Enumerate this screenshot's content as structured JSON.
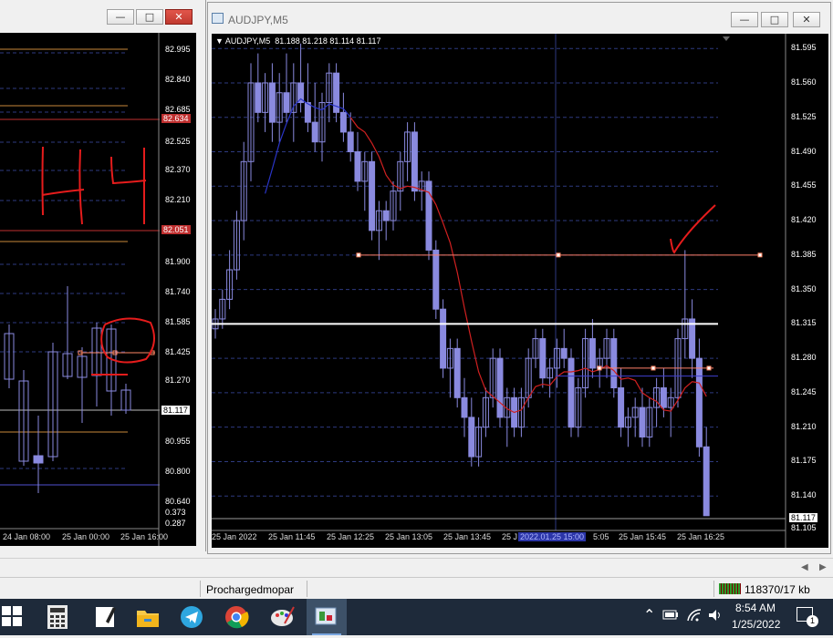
{
  "left_window": {
    "price_levels": [
      "82.995",
      "82.840",
      "82.685",
      "82.634",
      "82.525",
      "82.370",
      "82.210",
      "82.051",
      "81.900",
      "81.740",
      "81.585",
      "81.425",
      "81.270",
      "81.117",
      "80.955",
      "80.800",
      "80.640",
      "0.373",
      "0.287"
    ],
    "time_labels": [
      "24 Jan 08:00",
      "25 Jan 00:00",
      "25 Jan 16:00"
    ],
    "marker_red_1": "82.634",
    "marker_red_2": "82.051",
    "marker_current": "81.117",
    "annotation_text": "H4"
  },
  "right_window": {
    "title": "AUDJPY,M5",
    "chart_header": "AUDJPY,M5  81.188 81.218 81.114 81.117",
    "price_levels": [
      "81.595",
      "81.560",
      "81.525",
      "81.490",
      "81.455",
      "81.420",
      "81.385",
      "81.350",
      "81.315",
      "81.280",
      "81.245",
      "81.210",
      "81.175",
      "81.140",
      "81.117",
      "81.105"
    ],
    "current_price": "81.117",
    "time_labels": [
      "25 Jan 2022",
      "25 Jan 11:45",
      "25 Jan 12:25",
      "25 Jan 13:05",
      "25 Jan 13:45",
      "25 J",
      "2022.01.25 15:00",
      "5:05",
      "25 Jan 15:45",
      "25 Jan 16:25"
    ]
  },
  "window_buttons": {
    "minimize": "—",
    "maximize": "□",
    "close": "✕"
  },
  "statusbar": {
    "profile": "Prochargedmopar",
    "traffic": "118370/17 kb"
  },
  "taskbar": {
    "icons": [
      "windows-start",
      "calculator",
      "notepad",
      "file-explorer",
      "telegram",
      "chrome",
      "paint",
      "metatrader"
    ],
    "time": "8:54 AM",
    "date": "1/25/2022",
    "notif_count": "1"
  },
  "chart_data": {
    "type": "candlestick",
    "symbol": "AUDJPY",
    "timeframe": "M5",
    "ylim": [
      81.105,
      81.61
    ],
    "ohlc_header": {
      "open": 81.188,
      "high": 81.218,
      "low": 81.114,
      "close": 81.117
    },
    "candles": [
      [
        81.31,
        81.33,
        81.3,
        81.32
      ],
      [
        81.32,
        81.35,
        81.31,
        81.34
      ],
      [
        81.34,
        81.39,
        81.33,
        81.37
      ],
      [
        81.37,
        81.43,
        81.36,
        81.42
      ],
      [
        81.42,
        81.5,
        81.4,
        81.48
      ],
      [
        81.48,
        81.58,
        81.46,
        81.56
      ],
      [
        81.56,
        81.59,
        81.52,
        81.53
      ],
      [
        81.53,
        81.57,
        81.51,
        81.56
      ],
      [
        81.56,
        81.58,
        81.5,
        81.52
      ],
      [
        81.52,
        81.57,
        81.5,
        81.55
      ],
      [
        81.55,
        81.59,
        81.52,
        81.53
      ],
      [
        81.53,
        81.58,
        81.5,
        81.56
      ],
      [
        81.56,
        81.6,
        81.53,
        81.54
      ],
      [
        81.54,
        81.58,
        81.51,
        81.52
      ],
      [
        81.52,
        81.56,
        81.49,
        81.5
      ],
      [
        81.5,
        81.55,
        81.48,
        81.54
      ],
      [
        81.54,
        81.58,
        81.52,
        81.57
      ],
      [
        81.57,
        81.58,
        81.52,
        81.53
      ],
      [
        81.53,
        81.55,
        81.5,
        81.51
      ],
      [
        81.51,
        81.53,
        81.48,
        81.49
      ],
      [
        81.49,
        81.51,
        81.45,
        81.46
      ],
      [
        81.46,
        81.49,
        81.43,
        81.48
      ],
      [
        81.48,
        81.49,
        81.4,
        81.41
      ],
      [
        81.41,
        81.44,
        81.38,
        81.43
      ],
      [
        81.43,
        81.44,
        81.4,
        81.42
      ],
      [
        81.42,
        81.46,
        81.41,
        81.45
      ],
      [
        81.45,
        81.49,
        81.43,
        81.48
      ],
      [
        81.48,
        81.52,
        81.46,
        81.51
      ],
      [
        81.51,
        81.52,
        81.44,
        81.45
      ],
      [
        81.45,
        81.47,
        81.43,
        81.46
      ],
      [
        81.46,
        81.47,
        81.38,
        81.39
      ],
      [
        81.39,
        81.4,
        81.32,
        81.33
      ],
      [
        81.33,
        81.34,
        81.26,
        81.27
      ],
      [
        81.27,
        81.3,
        81.24,
        81.29
      ],
      [
        81.29,
        81.3,
        81.23,
        81.24
      ],
      [
        81.24,
        81.26,
        81.2,
        81.22
      ],
      [
        81.22,
        81.24,
        81.17,
        81.18
      ],
      [
        81.18,
        81.22,
        81.17,
        81.21
      ],
      [
        81.21,
        81.25,
        81.2,
        81.24
      ],
      [
        81.24,
        81.29,
        81.23,
        81.28
      ],
      [
        81.28,
        81.29,
        81.21,
        81.22
      ],
      [
        81.22,
        81.25,
        81.19,
        81.24
      ],
      [
        81.24,
        81.25,
        81.2,
        81.21
      ],
      [
        81.21,
        81.25,
        81.2,
        81.24
      ],
      [
        81.24,
        81.29,
        81.23,
        81.28
      ],
      [
        81.28,
        81.31,
        81.27,
        81.3
      ],
      [
        81.3,
        81.31,
        81.25,
        81.26
      ],
      [
        81.26,
        81.28,
        81.24,
        81.27
      ],
      [
        81.27,
        81.3,
        81.25,
        81.29
      ],
      [
        81.29,
        81.31,
        81.27,
        81.28
      ],
      [
        81.28,
        81.29,
        81.2,
        81.21
      ],
      [
        81.21,
        81.26,
        81.2,
        81.25
      ],
      [
        81.25,
        81.31,
        81.24,
        81.3
      ],
      [
        81.3,
        81.32,
        81.26,
        81.27
      ],
      [
        81.27,
        81.29,
        81.25,
        81.28
      ],
      [
        81.28,
        81.31,
        81.26,
        81.3
      ],
      [
        81.3,
        81.31,
        81.24,
        81.25
      ],
      [
        81.25,
        81.27,
        81.2,
        81.21
      ],
      [
        81.21,
        81.23,
        81.19,
        81.22
      ],
      [
        81.22,
        81.24,
        81.2,
        81.23
      ],
      [
        81.23,
        81.25,
        81.19,
        81.2
      ],
      [
        81.2,
        81.24,
        81.19,
        81.23
      ],
      [
        81.23,
        81.26,
        81.21,
        81.25
      ],
      [
        81.25,
        81.27,
        81.22,
        81.23
      ],
      [
        81.23,
        81.25,
        81.2,
        81.24
      ],
      [
        81.24,
        81.31,
        81.23,
        81.3
      ],
      [
        81.3,
        81.39,
        81.28,
        81.32
      ],
      [
        81.32,
        81.34,
        81.26,
        81.28
      ],
      [
        81.28,
        81.3,
        81.18,
        81.19
      ],
      [
        81.19,
        81.21,
        81.12,
        81.12
      ]
    ],
    "horizontal_lines": [
      {
        "price": 81.385,
        "color": "#ff7f6a"
      },
      {
        "price": 81.315,
        "color": "#ffffff"
      },
      {
        "price": 81.27,
        "color": "#ff7f6a"
      },
      {
        "price": 81.262,
        "color": "#4040d0"
      },
      {
        "price": 81.117,
        "color": "#9a9a9a"
      }
    ],
    "annotation": "checkmark near 81.42"
  }
}
